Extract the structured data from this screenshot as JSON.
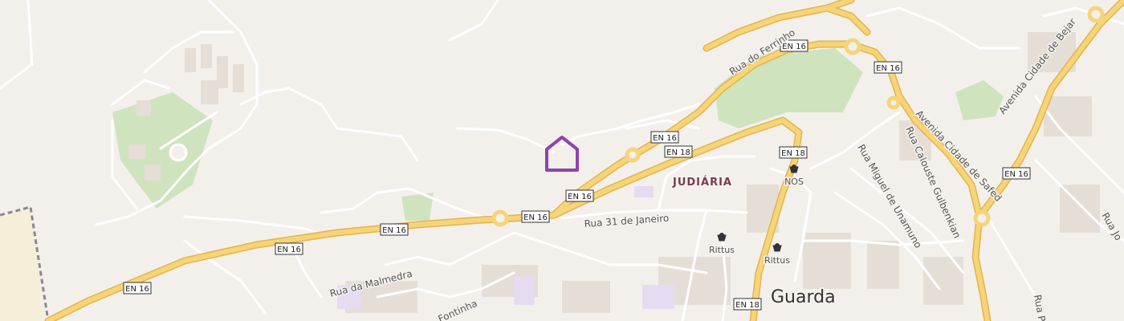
{
  "map": {
    "city_label": "Guarda",
    "district_label": "JUDIÁRIA",
    "marker": {
      "icon": "home-marker-icon",
      "color": "#8e44ad"
    },
    "colors": {
      "background": "#f3f0ec",
      "major_road": "#f6d47a",
      "major_road_casing": "#e8b94a",
      "minor_road": "#ffffff",
      "park": "#cfe3bf",
      "railway": "#8a8a8a",
      "building": "#e6e1da"
    },
    "road_shields": [
      "EN 16",
      "EN 16",
      "EN 16",
      "EN 16",
      "EN 16",
      "EN 16",
      "EN 16",
      "EN 16",
      "EN 18",
      "EN 18",
      "EN 18",
      "EN 16"
    ],
    "street_labels": [
      "Rua do Ferrinho",
      "Rua 31 de Janeiro",
      "Rua da Malmedra",
      "Fontinha",
      "Rua Miguel de Unamuno",
      "Rua Calouste Gulbenkian",
      "Avenida Cidade de Safed",
      "Avenida Cidade de Bejar",
      "Rua Jo",
      "Rua P"
    ],
    "pois": [
      {
        "label": "NOS",
        "icon": "shopping-bag-icon"
      },
      {
        "label": "Rittus",
        "icon": "shopping-bag-icon"
      },
      {
        "label": "Rittus",
        "icon": "shopping-bag-icon"
      }
    ]
  }
}
